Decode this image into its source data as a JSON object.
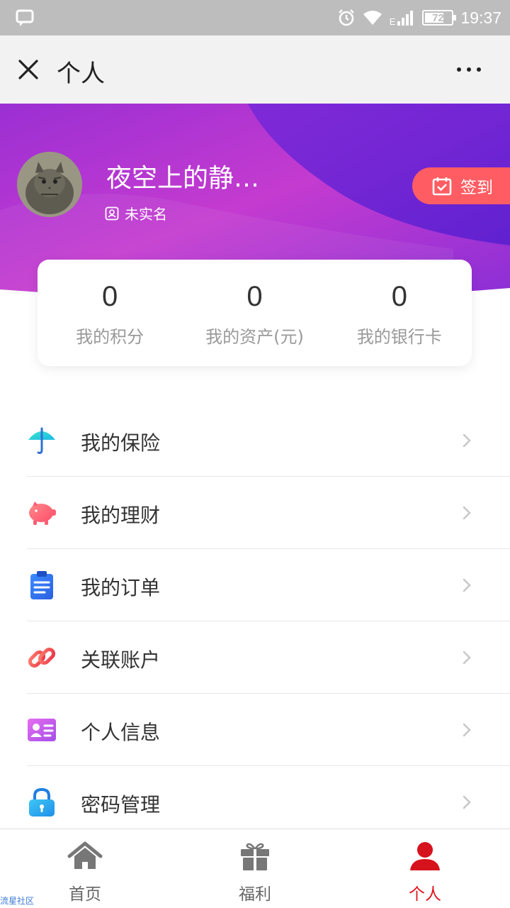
{
  "status_bar": {
    "time": "19:37",
    "battery": "72",
    "battery_level": 0.72,
    "network": "E"
  },
  "title_bar": {
    "title": "个人"
  },
  "profile": {
    "name": "夜空上的静谧...",
    "verify_status": "未实名",
    "checkin_label": "签到"
  },
  "stats": [
    {
      "value": "0",
      "label": "我的积分"
    },
    {
      "value": "0",
      "label": "我的资产(元)"
    },
    {
      "value": "0",
      "label": "我的银行卡"
    }
  ],
  "menu": [
    {
      "label": "我的保险",
      "icon": "umbrella-icon"
    },
    {
      "label": "我的理财",
      "icon": "piggy-bank-icon"
    },
    {
      "label": "我的订单",
      "icon": "clipboard-icon"
    },
    {
      "label": "关联账户",
      "icon": "link-icon"
    },
    {
      "label": "个人信息",
      "icon": "id-card-icon"
    },
    {
      "label": "密码管理",
      "icon": "lock-icon"
    }
  ],
  "bottom_nav": [
    {
      "label": "首页",
      "icon": "home-icon",
      "active": false
    },
    {
      "label": "福利",
      "icon": "gift-icon",
      "active": false
    },
    {
      "label": "个人",
      "icon": "person-icon",
      "active": true
    }
  ],
  "watermark": "流星社区",
  "colors": {
    "accent_red": "#e0141e",
    "checkin_bg": "#ff5d63",
    "header_purple": "#8a2fd6"
  }
}
